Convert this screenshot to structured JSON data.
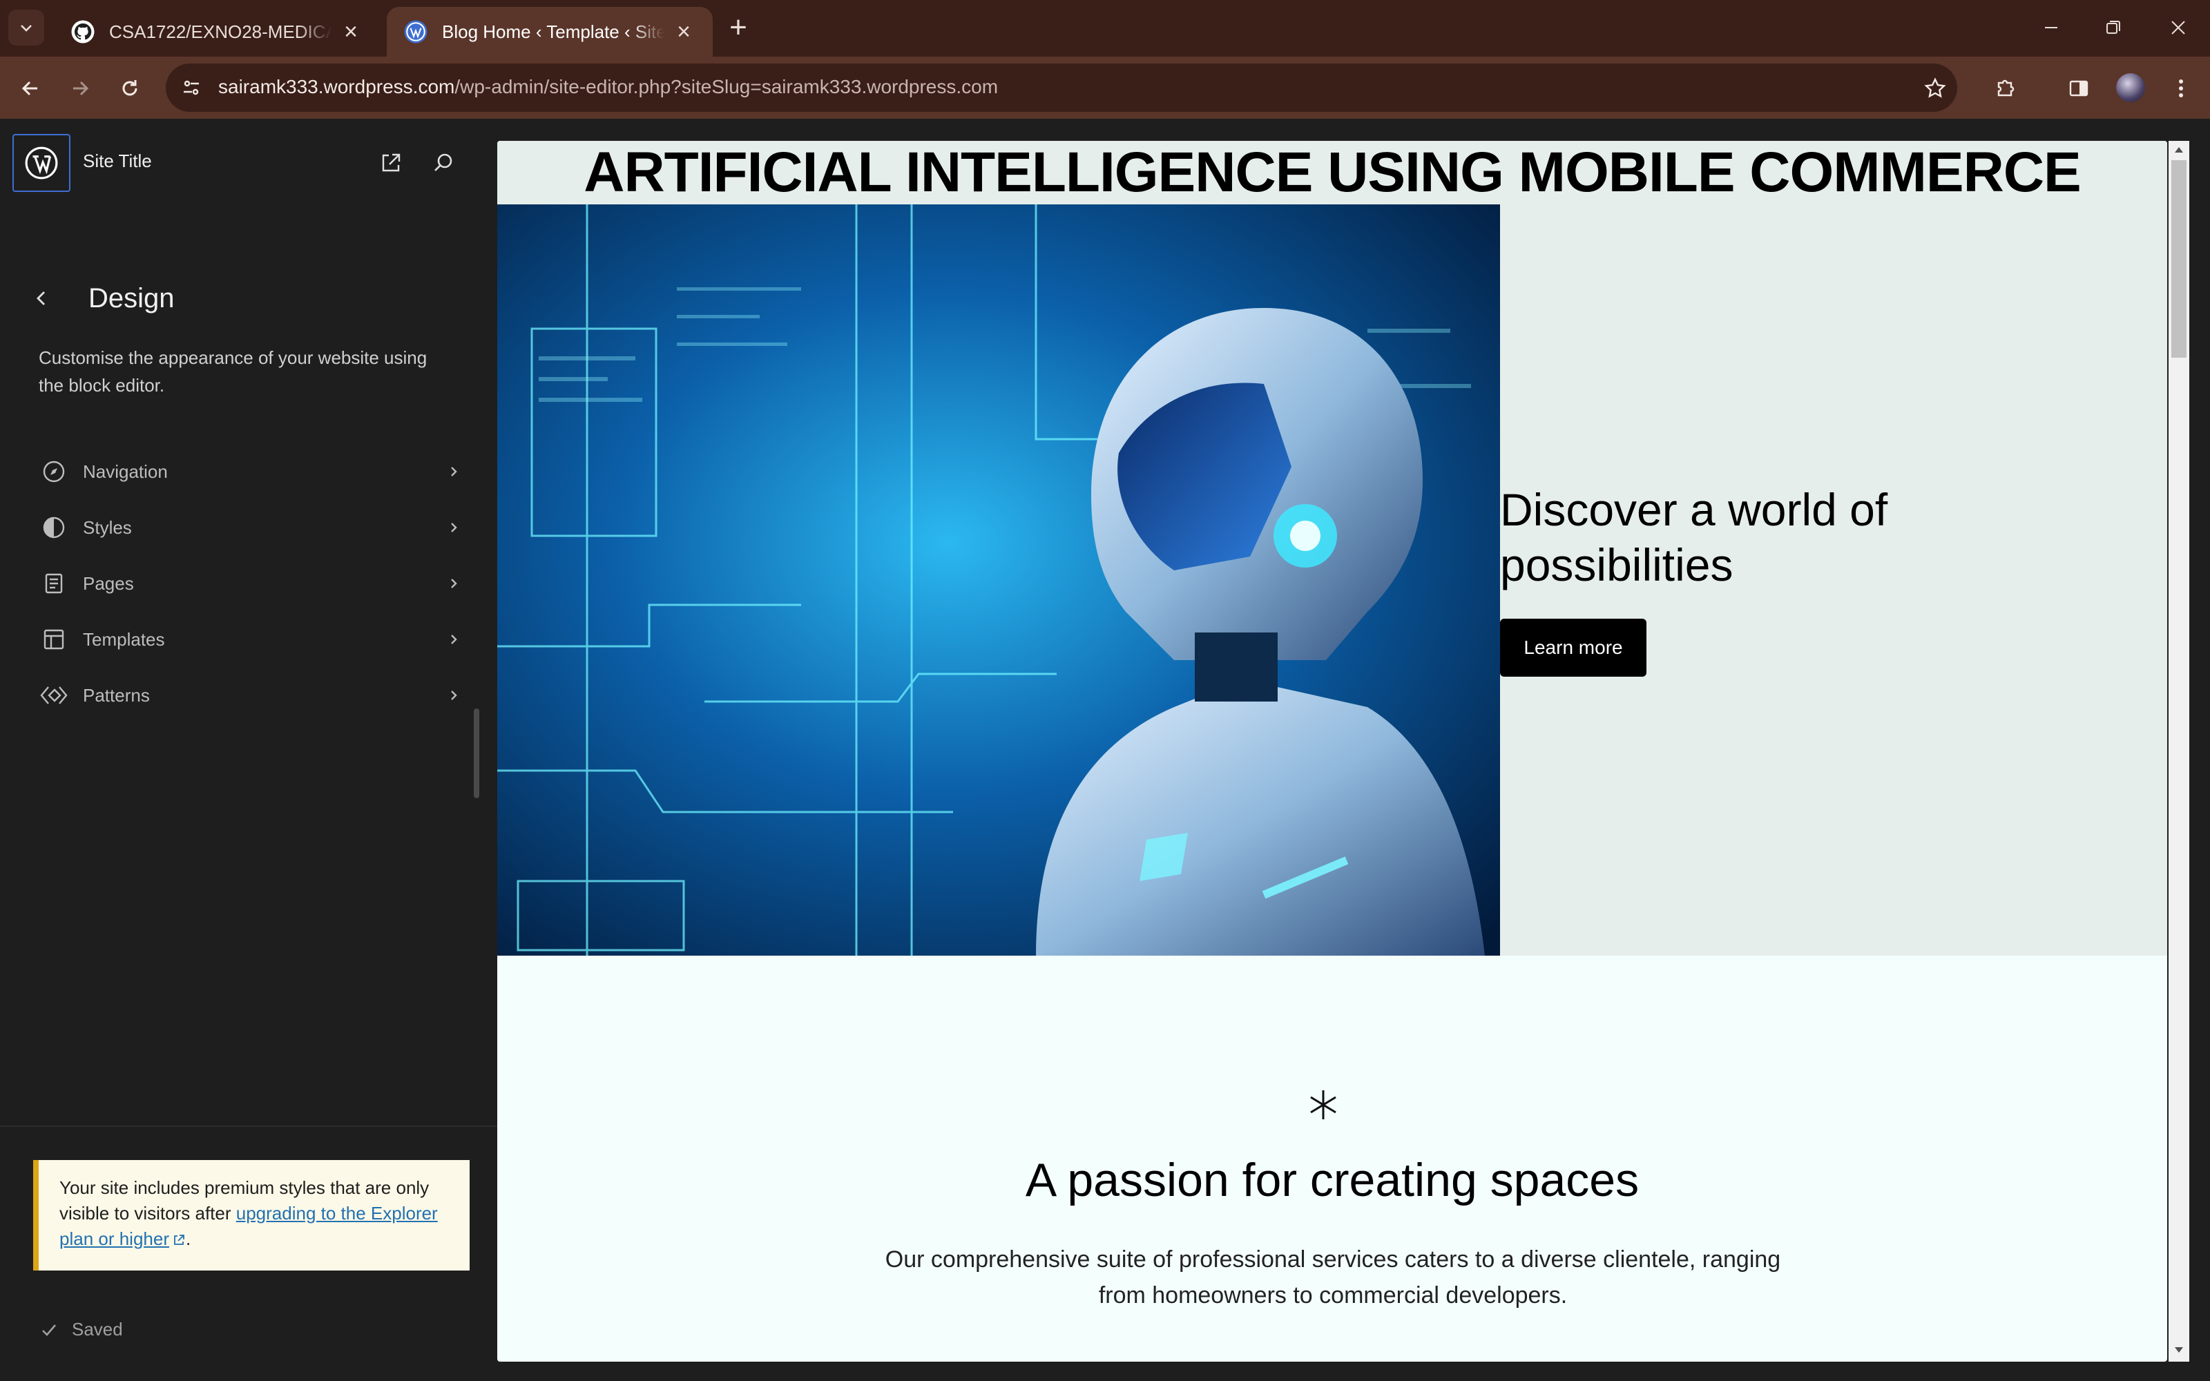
{
  "browser": {
    "tabs": [
      {
        "title": "CSA1722/EXNO28-MEDICAL DI",
        "favicon": "github-icon",
        "active": false
      },
      {
        "title": "Blog Home ‹ Template ‹ Site Tit",
        "favicon": "wordpress-icon",
        "active": true
      }
    ],
    "url_host": "sairamk333.wordpress.com",
    "url_path": "/wp-admin/site-editor.php?siteSlug=sairamk333.wordpress.com"
  },
  "sidebar": {
    "site_title": "Site Title",
    "heading": "Design",
    "description": "Customise the appearance of your website using the block editor.",
    "items": [
      {
        "label": "Navigation",
        "icon": "navigation-icon"
      },
      {
        "label": "Styles",
        "icon": "styles-icon"
      },
      {
        "label": "Pages",
        "icon": "pages-icon"
      },
      {
        "label": "Templates",
        "icon": "templates-icon"
      },
      {
        "label": "Patterns",
        "icon": "patterns-icon"
      }
    ],
    "notice": {
      "text": "Your site includes premium styles that are only visible to visitors after ",
      "link": "upgrading to the Explorer plan or higher",
      "end": "."
    },
    "status": "Saved"
  },
  "canvas": {
    "hero_heading": "ARTIFICIAL INTELLIGENCE USING MOBILE COMMERCE",
    "cover_heading": "Discover a world of possibilities",
    "cta": "Learn more",
    "section_heading": "A passion for creating spaces",
    "section_text": "Our comprehensive suite of professional services caters to a diverse clientele, ranging from homeowners to commercial developers."
  },
  "colors": {
    "titlebar": "#3a1f19",
    "toolbar": "#5a3529",
    "sidebar": "#1e1e1e",
    "accent_blue": "#3e6ed1",
    "notice_border": "#dba617"
  }
}
